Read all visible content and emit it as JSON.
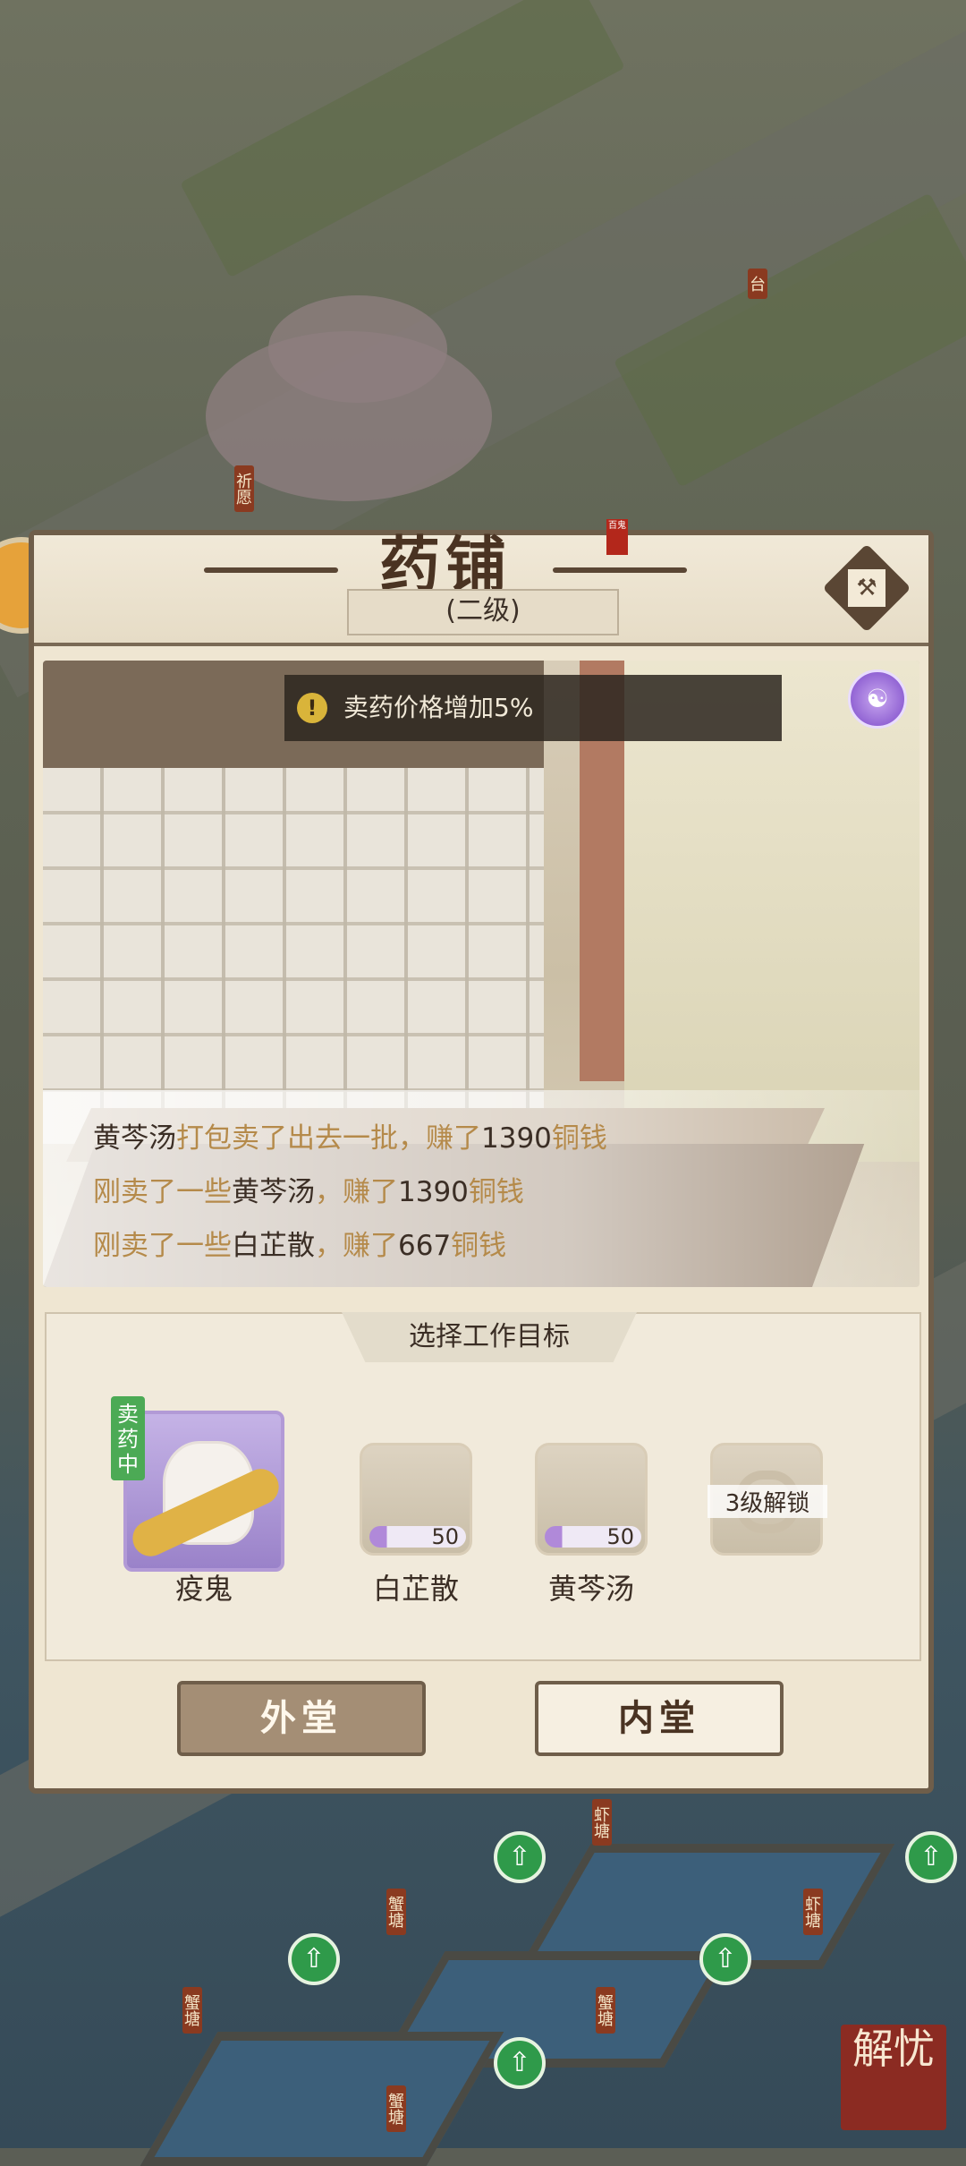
{
  "shop": {
    "title": "药铺",
    "seal_text": "百鬼",
    "level": "(二级)",
    "bonus": "卖药价格增加5%"
  },
  "log": [
    {
      "parts": [
        {
          "t": "黄芩汤",
          "c": "dark"
        },
        {
          "t": "打包卖了出去一批，赚了",
          "c": "gold"
        },
        {
          "t": "1390",
          "c": "dark"
        },
        {
          "t": "铜钱",
          "c": "gold"
        }
      ]
    },
    {
      "parts": [
        {
          "t": "刚卖了一些",
          "c": "gold"
        },
        {
          "t": "黄芩汤",
          "c": "dark"
        },
        {
          "t": "，赚了",
          "c": "gold"
        },
        {
          "t": "1390",
          "c": "dark"
        },
        {
          "t": "铜钱",
          "c": "gold"
        }
      ]
    },
    {
      "parts": [
        {
          "t": "刚卖了一些",
          "c": "gold"
        },
        {
          "t": "白芷散",
          "c": "dark"
        },
        {
          "t": "，赚了",
          "c": "gold"
        },
        {
          "t": "667",
          "c": "dark"
        },
        {
          "t": "铜钱",
          "c": "gold"
        }
      ]
    }
  ],
  "work": {
    "title": "选择工作目标",
    "worker": {
      "name": "疫鬼",
      "status": "卖药中"
    },
    "items": [
      {
        "name": "白芷散",
        "count": "50",
        "progress": 0.18
      },
      {
        "name": "黄芩汤",
        "count": "50",
        "progress": 0.18
      }
    ],
    "locked_label": "3级解锁"
  },
  "buttons": {
    "outer": "外堂",
    "inner": "内堂"
  },
  "map": {
    "signs": [
      "祈愿",
      "台",
      "虾塘",
      "蟹塘",
      "蟹塘",
      "虾塘",
      "蟹塘",
      "蟹塘",
      "蟹塘"
    ],
    "seal": "解忧"
  }
}
